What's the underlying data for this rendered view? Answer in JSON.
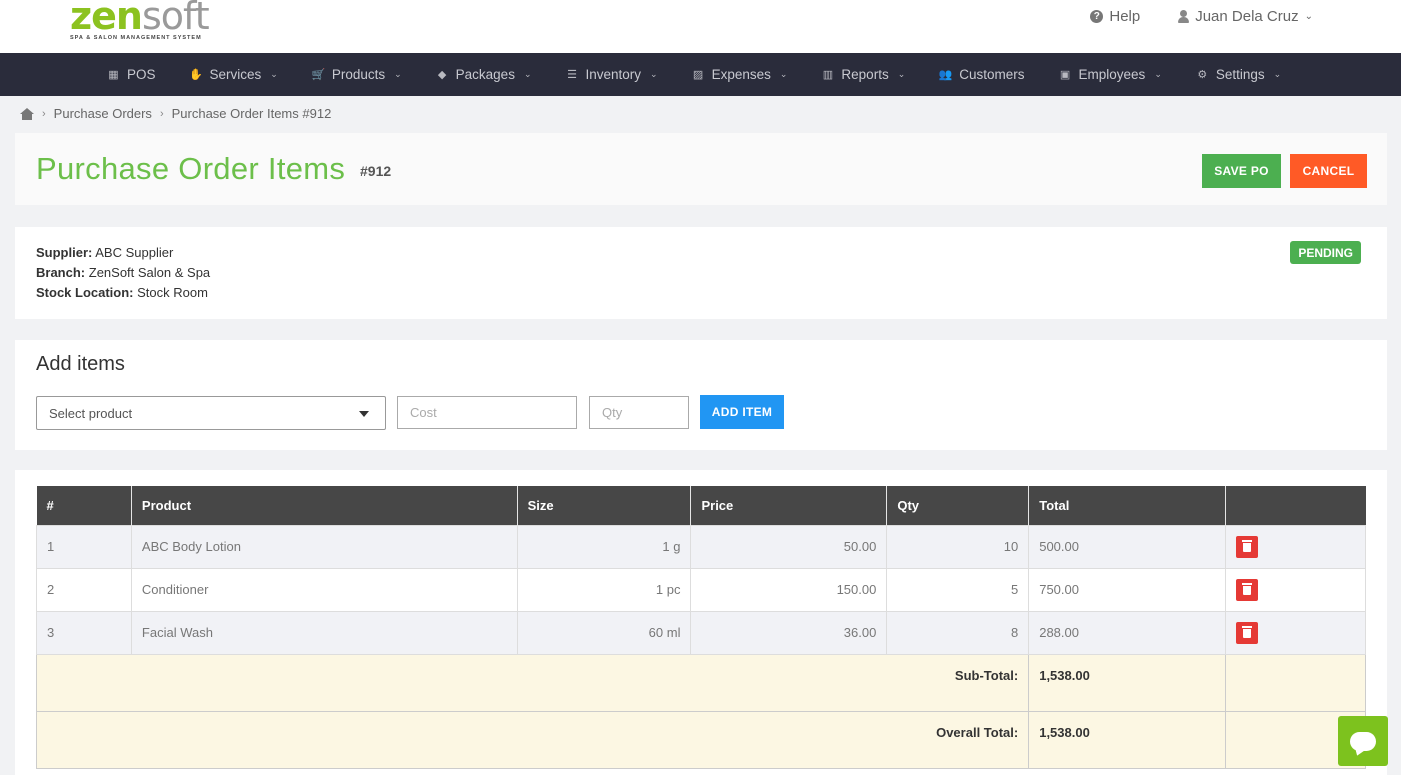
{
  "brand": {
    "logo_main": "zen",
    "logo_soft": "soft",
    "tagline": "SPA & SALON MANAGEMENT SYSTEM"
  },
  "header": {
    "help": "Help",
    "user": "Juan Dela Cruz"
  },
  "nav": [
    {
      "label": "POS",
      "icon": "pos-icon",
      "glyph": "▦",
      "caret": false
    },
    {
      "label": "Services",
      "icon": "services-icon",
      "glyph": "✋",
      "caret": true
    },
    {
      "label": "Products",
      "icon": "cart-icon",
      "glyph": "🛒",
      "caret": true
    },
    {
      "label": "Packages",
      "icon": "tag-icon",
      "glyph": "◆",
      "caret": true
    },
    {
      "label": "Inventory",
      "icon": "list-icon",
      "glyph": "☰",
      "caret": true
    },
    {
      "label": "Expenses",
      "icon": "expenses-icon",
      "glyph": "▨",
      "caret": true
    },
    {
      "label": "Reports",
      "icon": "chart-icon",
      "glyph": "▥",
      "caret": true
    },
    {
      "label": "Customers",
      "icon": "customers-icon",
      "glyph": "👥",
      "caret": false
    },
    {
      "label": "Employees",
      "icon": "briefcase-icon",
      "glyph": "▣",
      "caret": true
    },
    {
      "label": "Settings",
      "icon": "gear-icon",
      "glyph": "⚙",
      "caret": true
    }
  ],
  "breadcrumb": {
    "item1": "Purchase Orders",
    "item2": "Purchase Order Items #912"
  },
  "page": {
    "title": "Purchase Order Items",
    "po_number": "#912",
    "save_label": "SAVE PO",
    "cancel_label": "CANCEL"
  },
  "info": {
    "supplier_label": "Supplier:",
    "supplier": "ABC Supplier",
    "branch_label": "Branch:",
    "branch": "ZenSoft Salon & Spa",
    "location_label": "Stock Location:",
    "location": "Stock Room",
    "status": "PENDING",
    "status_color": "#4caf50"
  },
  "add_items": {
    "title": "Add items",
    "select_placeholder": "Select product",
    "cost_placeholder": "Cost",
    "qty_placeholder": "Qty",
    "add_label": "ADD ITEM"
  },
  "table": {
    "headers": [
      "#",
      "Product",
      "Size",
      "Price",
      "Qty",
      "Total",
      ""
    ],
    "rows": [
      {
        "num": "1",
        "product": "ABC Body Lotion",
        "size": "1 g",
        "price": "50.00",
        "qty": "10",
        "total": "500.00"
      },
      {
        "num": "2",
        "product": "Conditioner",
        "size": "1 pc",
        "price": "150.00",
        "qty": "5",
        "total": "750.00"
      },
      {
        "num": "3",
        "product": "Facial Wash",
        "size": "60 ml",
        "price": "36.00",
        "qty": "8",
        "total": "288.00"
      }
    ],
    "subtotal_label": "Sub-Total:",
    "subtotal": "1,538.00",
    "overall_label": "Overall Total:",
    "overall": "1,538.00"
  },
  "colors": {
    "accent_green": "#6cbf4a",
    "save": "#4caf50",
    "cancel": "#ff5a26",
    "add": "#2196f3",
    "delete": "#e53935",
    "nav_bg": "#2a2c3b",
    "chat": "#7dc21e"
  }
}
